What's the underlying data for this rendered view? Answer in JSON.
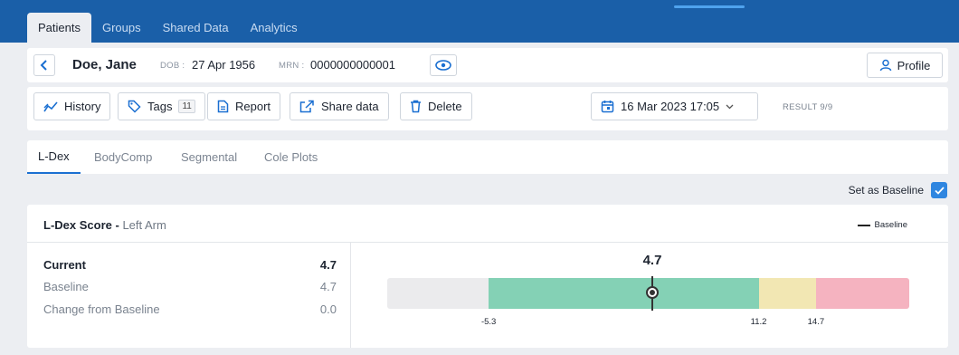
{
  "nav": {
    "tabs": [
      {
        "label": "Patients"
      },
      {
        "label": "Groups"
      },
      {
        "label": "Shared Data"
      },
      {
        "label": "Analytics"
      }
    ]
  },
  "patient": {
    "name": "Doe, Jane",
    "dob_label": "DOB :",
    "dob": "27 Apr 1956",
    "mrn_label": "MRN :",
    "mrn": "0000000000001",
    "profile_label": "Profile"
  },
  "toolbar": {
    "history_label": "History",
    "tags_label": "Tags",
    "tags_count": "11",
    "report_label": "Report",
    "share_label": "Share data",
    "delete_label": "Delete",
    "date_label": "16 Mar 2023 17:05",
    "result_label": "RESULT 9/9"
  },
  "subtabs": [
    {
      "label": "L-Dex"
    },
    {
      "label": "BodyComp"
    },
    {
      "label": "Segmental"
    },
    {
      "label": "Cole Plots"
    }
  ],
  "baseline": {
    "label": "Set as Baseline",
    "checked": true
  },
  "card": {
    "title": "L-Dex Score -",
    "subtitle": "Left Arm",
    "legend_label": "Baseline",
    "stats": [
      {
        "label": "Current",
        "value": "4.7"
      },
      {
        "label": "Baseline",
        "value": "4.7"
      },
      {
        "label": "Change from Baseline",
        "value": "0.0"
      }
    ]
  },
  "gauge": {
    "value_label": "4.7",
    "value": 4.7,
    "baseline_value": 4.7,
    "range": [
      -11.5,
      20.4
    ],
    "thresholds": [
      -5.3,
      11.2,
      14.7
    ],
    "threshold_labels": [
      "-5.3",
      "11.2",
      "14.7"
    ],
    "colors": {
      "low": "#ebebed",
      "normal": "#84d1b5",
      "caution": "#f2e7b3",
      "high": "#f5b3c0"
    }
  },
  "colors": {
    "brand": "#1a5fa8",
    "accent": "#2f86e0"
  }
}
